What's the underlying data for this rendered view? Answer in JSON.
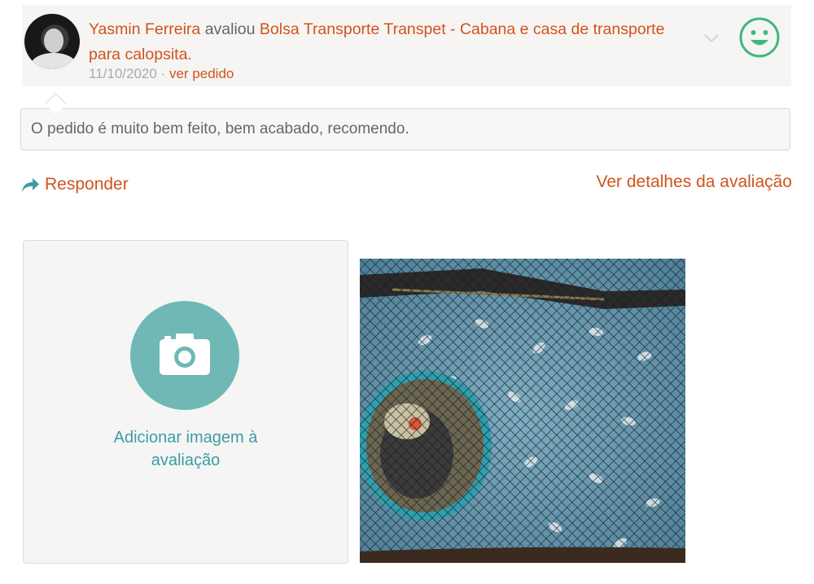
{
  "review": {
    "reviewer": "Yasmin Ferreira",
    "action": "avaliou",
    "product": "Bolsa Transporte Transpet - Cabana e casa de transporte para calopsita.",
    "date": "11/10/2020",
    "separator": "·",
    "order_link": "ver pedido",
    "rating_icon": "happy-face-icon",
    "comment": "O pedido é muito bem feito, bem acabado, recomendo."
  },
  "actions": {
    "reply_label": "Responder",
    "details_label": "Ver detalhes da avaliação"
  },
  "upload": {
    "label": "Adicionar imagem à avaliação",
    "icon": "camera-icon"
  },
  "colors": {
    "accent": "#d2531c",
    "teal": "#6fb8b5",
    "smiley_green": "#3fb97a"
  }
}
